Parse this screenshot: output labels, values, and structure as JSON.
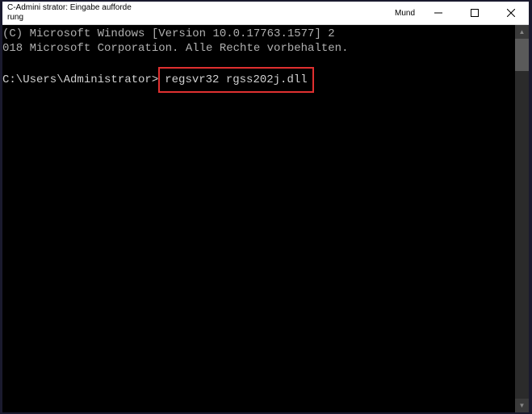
{
  "titlebar": {
    "title": "C-Admini strator: Eingabe aufforde rung",
    "tab_label": "Mund"
  },
  "console": {
    "line1": "(C) Microsoft Windows [Version 10.0.17763.1577] 2",
    "line2": "018 Microsoft Corporation. Alle Rechte vorbehalten.",
    "prompt_prefix": "C:\\Users\\Administrator>",
    "command": "regsvr32 rgss202j.dll"
  },
  "icons": {
    "minimize": "minimize",
    "maximize": "maximize",
    "close": "close",
    "scroll_up": "▲",
    "scroll_down": "▼"
  }
}
